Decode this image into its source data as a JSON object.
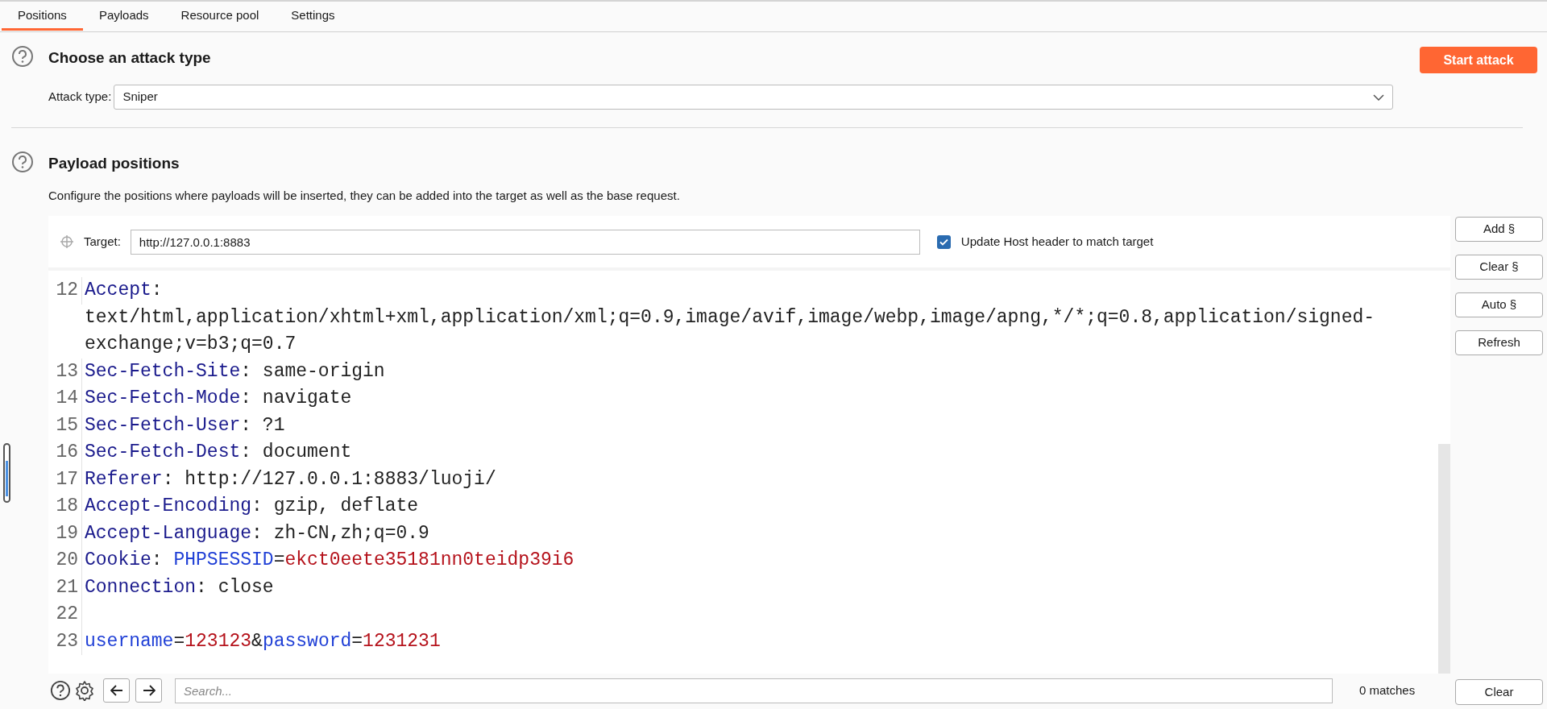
{
  "tabs": [
    {
      "label": "Positions",
      "selected": true
    },
    {
      "label": "Payloads",
      "selected": false
    },
    {
      "label": "Resource pool",
      "selected": false
    },
    {
      "label": "Settings",
      "selected": false
    }
  ],
  "attack_section": {
    "title": "Choose an attack type",
    "start_button": "Start attack",
    "attack_type_label": "Attack type:",
    "attack_type_value": "Sniper"
  },
  "positions_section": {
    "title": "Payload positions",
    "description": "Configure the positions where payloads will be inserted, they can be added into the target as well as the base request."
  },
  "target": {
    "label": "Target:",
    "value": "http://127.0.0.1:8883",
    "update_host": {
      "label": "Update Host header to match target",
      "checked": true
    }
  },
  "side_buttons": [
    "Add §",
    "Clear §",
    "Auto §",
    "Refresh"
  ],
  "editor_lines": [
    {
      "number": "12",
      "segments": [
        {
          "kind": "name",
          "text": "Accept"
        },
        {
          "kind": "plain",
          "text": ": text/html,application/xhtml+xml,application/xml;q=0.9,image/avif,image/webp,image/apng,*/*;q=0.8,application/signed-exchange;v=b3;q=0.7"
        }
      ]
    },
    {
      "number": "13",
      "segments": [
        {
          "kind": "name",
          "text": "Sec-Fetch-Site"
        },
        {
          "kind": "plain",
          "text": ": same-origin"
        }
      ]
    },
    {
      "number": "14",
      "segments": [
        {
          "kind": "name",
          "text": "Sec-Fetch-Mode"
        },
        {
          "kind": "plain",
          "text": ": navigate"
        }
      ]
    },
    {
      "number": "15",
      "segments": [
        {
          "kind": "name",
          "text": "Sec-Fetch-User"
        },
        {
          "kind": "plain",
          "text": ": ?1"
        }
      ]
    },
    {
      "number": "16",
      "segments": [
        {
          "kind": "name",
          "text": "Sec-Fetch-Dest"
        },
        {
          "kind": "plain",
          "text": ": document"
        }
      ]
    },
    {
      "number": "17",
      "segments": [
        {
          "kind": "name",
          "text": "Referer"
        },
        {
          "kind": "plain",
          "text": ": http://127.0.0.1:8883/luoji/"
        }
      ]
    },
    {
      "number": "18",
      "segments": [
        {
          "kind": "name",
          "text": "Accept-Encoding"
        },
        {
          "kind": "plain",
          "text": ": gzip, deflate"
        }
      ]
    },
    {
      "number": "19",
      "segments": [
        {
          "kind": "name",
          "text": "Accept-Language"
        },
        {
          "kind": "plain",
          "text": ": zh-CN,zh;q=0.9"
        }
      ]
    },
    {
      "number": "20",
      "segments": [
        {
          "kind": "name",
          "text": "Cookie"
        },
        {
          "kind": "plain",
          "text": ": "
        },
        {
          "kind": "param",
          "text": "PHPSESSID"
        },
        {
          "kind": "plain",
          "text": "="
        },
        {
          "kind": "value",
          "text": "ekct0eete35181nn0teidp39i6"
        }
      ]
    },
    {
      "number": "21",
      "segments": [
        {
          "kind": "name",
          "text": "Connection"
        },
        {
          "kind": "plain",
          "text": ": close"
        }
      ]
    },
    {
      "number": "22"
    },
    {
      "number": "23",
      "segments": [
        {
          "kind": "param",
          "text": "username"
        },
        {
          "kind": "plain",
          "text": "="
        },
        {
          "kind": "value",
          "text": "123123"
        },
        {
          "kind": "plain",
          "text": "&"
        },
        {
          "kind": "param",
          "text": "password"
        },
        {
          "kind": "plain",
          "text": "="
        },
        {
          "kind": "value",
          "text": "1231231"
        }
      ]
    }
  ],
  "search": {
    "placeholder": "Search...",
    "matches": "0 matches",
    "clear_button": "Clear"
  }
}
